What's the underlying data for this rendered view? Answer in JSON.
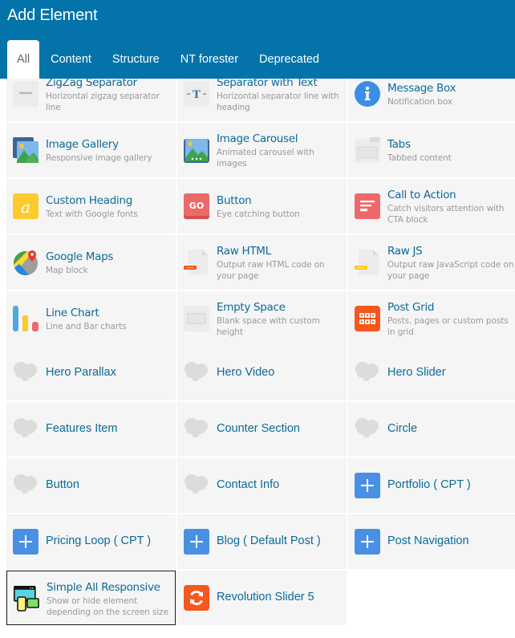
{
  "header": {
    "title": "Add Element",
    "tabs": [
      {
        "label": "All",
        "active": true
      },
      {
        "label": "Content",
        "active": false
      },
      {
        "label": "Structure",
        "active": false
      },
      {
        "label": "NT forester",
        "active": false
      },
      {
        "label": "Deprecated",
        "active": false
      }
    ]
  },
  "elements": [
    {
      "name": "ZigZag Separator",
      "desc": "Horizontal zigzag separator line",
      "icon": "zigzag-icon"
    },
    {
      "name": "Separator with Text",
      "desc": "Horizontal separator line with heading",
      "icon": "text-separator-icon"
    },
    {
      "name": "Message Box",
      "desc": "Notification box",
      "icon": "info-icon"
    },
    {
      "name": "Image Gallery",
      "desc": "Responsive image gallery",
      "icon": "image-gallery-icon"
    },
    {
      "name": "Image Carousel",
      "desc": "Animated carousel with images",
      "icon": "image-carousel-icon"
    },
    {
      "name": "Tabs",
      "desc": "Tabbed content",
      "icon": "tabs-icon"
    },
    {
      "name": "Custom Heading",
      "desc": "Text with Google fonts",
      "icon": "custom-heading-icon"
    },
    {
      "name": "Button",
      "desc": "Eye catching button",
      "icon": "go-button-icon"
    },
    {
      "name": "Call to Action",
      "desc": "Catch visitors attention with CTA block",
      "icon": "call-to-action-icon"
    },
    {
      "name": "Google Maps",
      "desc": "Map block",
      "icon": "map-icon"
    },
    {
      "name": "Raw HTML",
      "desc": "Output raw HTML code on your page",
      "icon": "raw-html-icon"
    },
    {
      "name": "Raw JS",
      "desc": "Output raw JavaScript code on your page",
      "icon": "raw-js-icon"
    },
    {
      "name": "Line Chart",
      "desc": "Line and Bar charts",
      "icon": "bar-chart-icon"
    },
    {
      "name": "Empty Space",
      "desc": "Blank space with custom height",
      "icon": "empty-space-icon"
    },
    {
      "name": "Post Grid",
      "desc": "Posts, pages or custom posts in grid",
      "icon": "post-grid-icon"
    },
    {
      "name": "Hero Parallax",
      "desc": "",
      "icon": "cloud-icon"
    },
    {
      "name": "Hero Video",
      "desc": "",
      "icon": "cloud-icon"
    },
    {
      "name": "Hero Slider",
      "desc": "",
      "icon": "cloud-icon"
    },
    {
      "name": "Features Item",
      "desc": "",
      "icon": "cloud-icon"
    },
    {
      "name": "Counter Section",
      "desc": "",
      "icon": "cloud-icon"
    },
    {
      "name": "Circle",
      "desc": "",
      "icon": "cloud-icon"
    },
    {
      "name": "Button",
      "desc": "",
      "icon": "cloud-icon"
    },
    {
      "name": "Contact Info",
      "desc": "",
      "icon": "cloud-icon"
    },
    {
      "name": "Portfolio ( CPT )",
      "desc": "",
      "icon": "plus-icon"
    },
    {
      "name": "Pricing Loop ( CPT )",
      "desc": "",
      "icon": "plus-icon"
    },
    {
      "name": "Blog ( Default Post )",
      "desc": "",
      "icon": "plus-icon"
    },
    {
      "name": "Post Navigation",
      "desc": "",
      "icon": "plus-icon"
    },
    {
      "name": "Simple All Responsive",
      "desc": "Show or hide element depending on the screen size",
      "icon": "responsive-devices-icon",
      "selected": true
    },
    {
      "name": "Revolution Slider 5",
      "desc": "",
      "icon": "revolution-slider-icon"
    }
  ],
  "colors": {
    "header": "#0473aa",
    "link": "#0b6a99",
    "cell_bg": "#f5f5f5",
    "plus_blue": "#4a90e2",
    "orange": "#f4581c"
  }
}
